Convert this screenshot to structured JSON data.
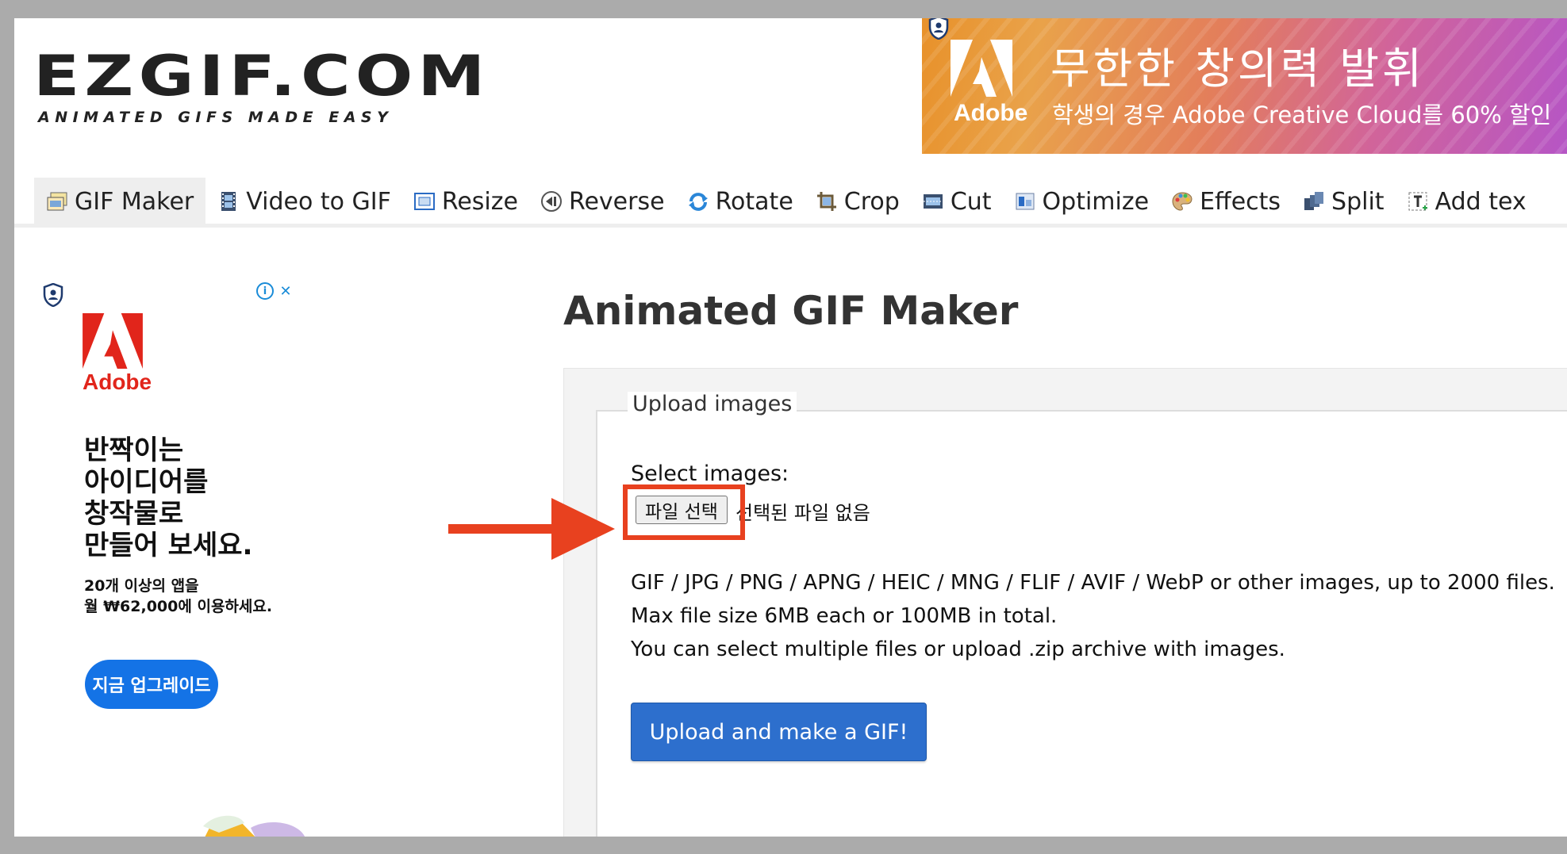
{
  "logo": {
    "main": "EZGIF.COM",
    "tagline": "ANIMATED GIFS MADE EASY"
  },
  "top_ad": {
    "brand": "Adobe",
    "headline": "무한한 창의력 발휘",
    "subline": "학생의 경우 Adobe Creative Cloud를 60% 할인",
    "brand_color": "#e8912a"
  },
  "nav": {
    "items": [
      {
        "label": "GIF Maker",
        "icon": "gif-maker-icon",
        "active": true
      },
      {
        "label": "Video to GIF",
        "icon": "film-icon"
      },
      {
        "label": "Resize",
        "icon": "resize-icon"
      },
      {
        "label": "Reverse",
        "icon": "reverse-icon"
      },
      {
        "label": "Rotate",
        "icon": "rotate-icon"
      },
      {
        "label": "Crop",
        "icon": "crop-icon"
      },
      {
        "label": "Cut",
        "icon": "cut-icon"
      },
      {
        "label": "Optimize",
        "icon": "optimize-icon"
      },
      {
        "label": "Effects",
        "icon": "palette-icon"
      },
      {
        "label": "Split",
        "icon": "split-icon"
      },
      {
        "label": "Add tex",
        "icon": "add-text-icon"
      }
    ]
  },
  "side_ad": {
    "brand": "Adobe",
    "copy_lines": [
      "반짝이는",
      "아이디어를",
      "창작물로",
      "만들어 보세요."
    ],
    "fine_lines": [
      "20개 이상의 앱을",
      "월 ₩62,000에 이용하세요."
    ],
    "cta": "지금 업그레이드",
    "info_glyph": "i",
    "close_glyph": "✕"
  },
  "main": {
    "title": "Animated GIF Maker",
    "legend": "Upload images",
    "select_label": "Select images:",
    "file_button": "파일 선택",
    "no_file": "선택된 파일 없음",
    "info_lines": [
      "GIF / JPG / PNG / APNG / HEIC / MNG / FLIF / AVIF / WebP or other images, up to 2000 files.",
      "Max file size 6MB each or 100MB in total.",
      "You can select multiple files or upload .zip archive with images."
    ],
    "upload_button": "Upload and make a GIF!"
  },
  "colors": {
    "annotation_red": "#e8411f",
    "upload_blue": "#2d6fcd",
    "cta_blue": "#1473e6",
    "adobe_red": "#e1251b"
  }
}
